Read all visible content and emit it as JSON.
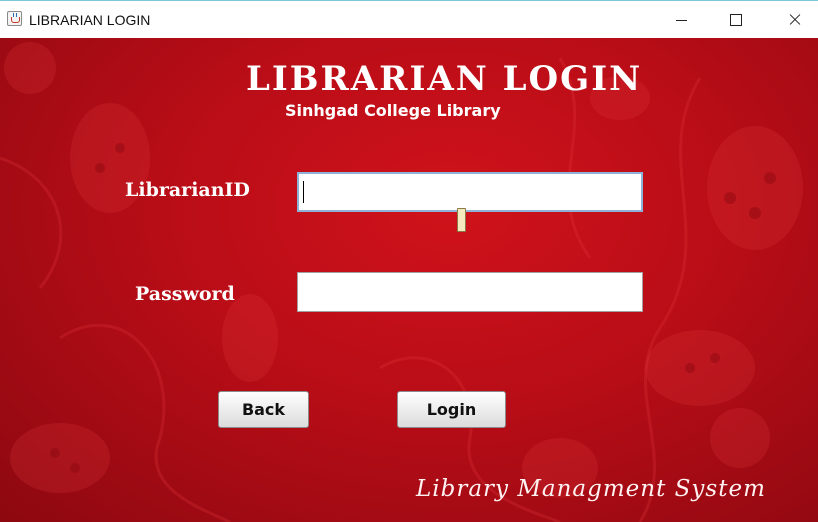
{
  "window": {
    "title": "LIBRARIAN LOGIN",
    "controls": {
      "minimize_icon": "minimize-icon",
      "maximize_icon": "maximize-icon",
      "close_icon": "close-icon"
    }
  },
  "header": {
    "title": "LIBRARIAN LOGIN",
    "subtitle": "Sinhgad College Library"
  },
  "form": {
    "librarian_id": {
      "label": "LibrarianID",
      "value": "",
      "placeholder": ""
    },
    "password": {
      "label": "Password",
      "value": "",
      "placeholder": ""
    }
  },
  "buttons": {
    "back_label": "Back",
    "login_label": "Login"
  },
  "footer": {
    "text": "Library Managment System"
  },
  "theme": {
    "background_red": "#b80d17",
    "text_white": "#ffffff"
  }
}
